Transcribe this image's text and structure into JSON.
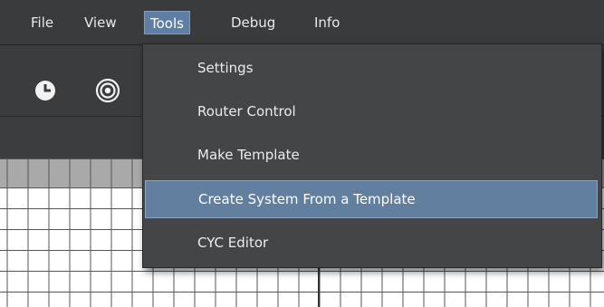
{
  "menubar": {
    "file": "File",
    "view": "View",
    "tools": "Tools",
    "debug": "Debug",
    "info": "Info"
  },
  "tools_menu": {
    "items": [
      {
        "label": "Settings",
        "highlighted": false
      },
      {
        "label": "Router Control",
        "highlighted": false
      },
      {
        "label": "Make Template",
        "highlighted": false
      },
      {
        "label": "Create System From a Template",
        "highlighted": true
      },
      {
        "label": "CYC Editor",
        "highlighted": false
      }
    ]
  },
  "toolbar": {
    "icons": [
      "clock-icon",
      "target-icon"
    ]
  },
  "colors": {
    "menubar_bg": "#3a3b3c",
    "menu_bg": "#444546",
    "highlight": "#637f9f",
    "active_menu": "#5e7ea3"
  }
}
